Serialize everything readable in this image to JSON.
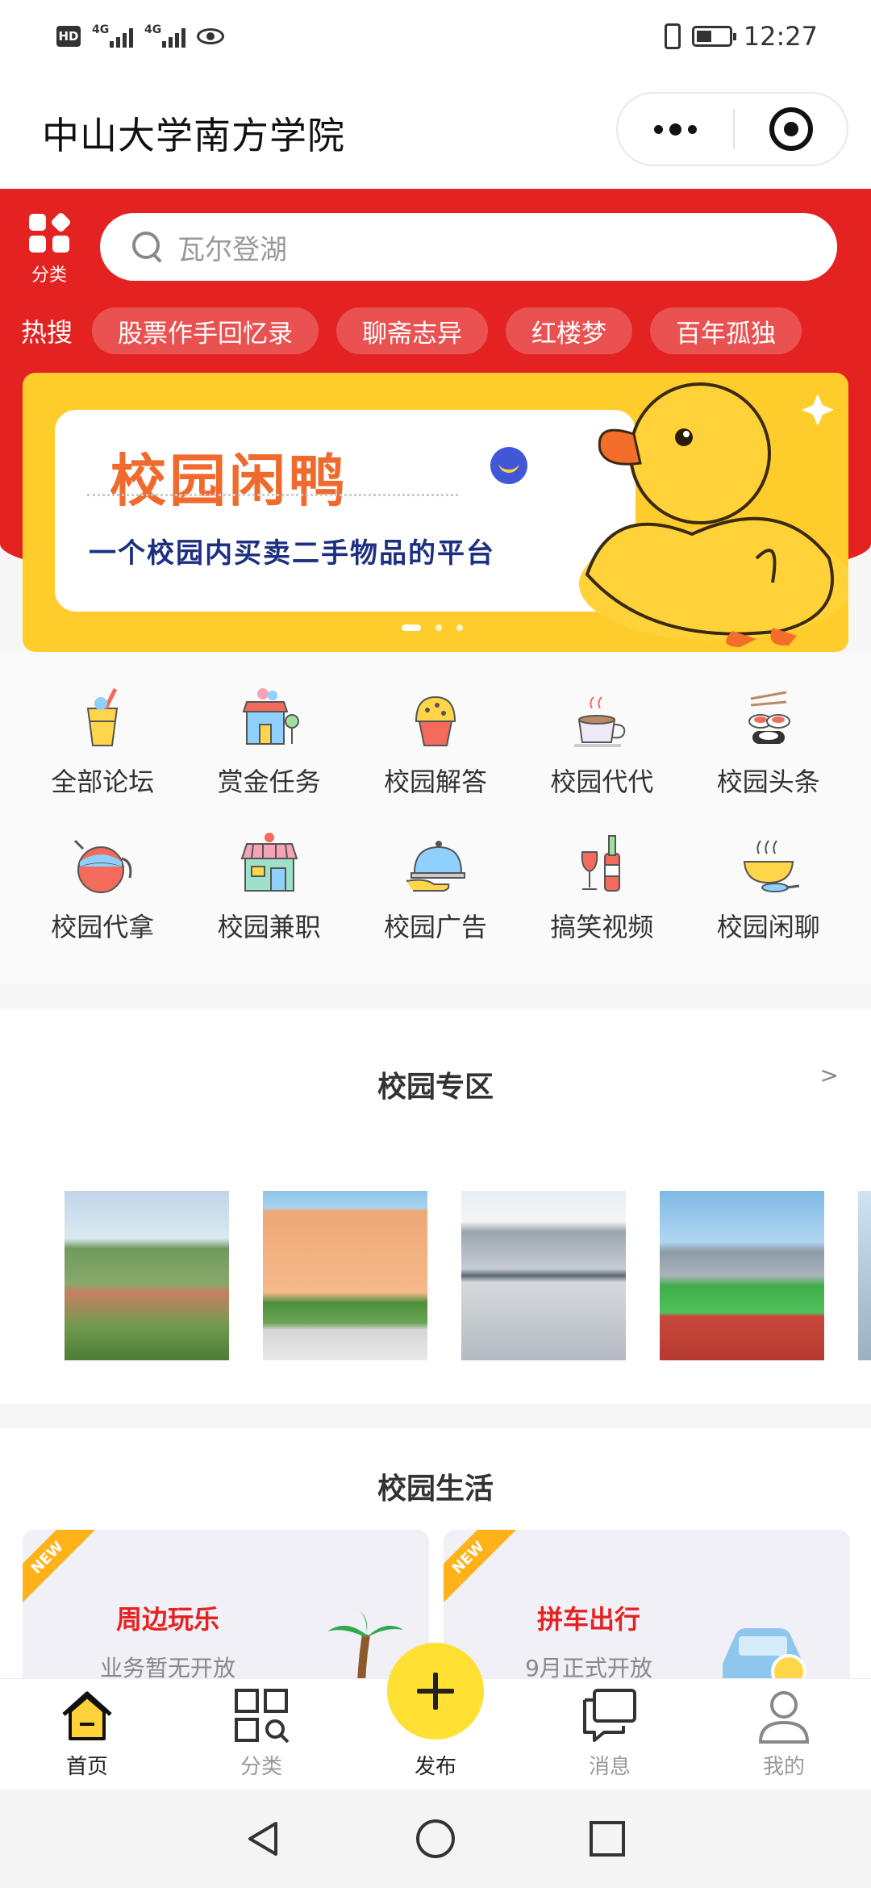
{
  "status_bar": {
    "hd": "HD",
    "net1": "4G",
    "net2": "4G",
    "time": "12:27"
  },
  "title_bar": {
    "title": "中山大学南方学院"
  },
  "header": {
    "category_label": "分类",
    "search_placeholder": "瓦尔登湖",
    "hot_label": "热搜",
    "hot_tags": [
      "股票作手回忆录",
      "聊斋志异",
      "红楼梦",
      "百年孤独"
    ]
  },
  "banner": {
    "title": "校园闲鸭",
    "subtitle": "一个校园内买卖二手物品的平台"
  },
  "menu": {
    "items": [
      {
        "label": "全部论坛",
        "icon": "drink-icon"
      },
      {
        "label": "赏金任务",
        "icon": "shop-icon"
      },
      {
        "label": "校园解答",
        "icon": "muffin-icon"
      },
      {
        "label": "校园代代",
        "icon": "coffee-cup-icon"
      },
      {
        "label": "校园头条",
        "icon": "sushi-icon"
      },
      {
        "label": "校园代拿",
        "icon": "kettle-icon"
      },
      {
        "label": "校园兼职",
        "icon": "store-icon"
      },
      {
        "label": "校园广告",
        "icon": "cloche-icon"
      },
      {
        "label": "搞笑视频",
        "icon": "wine-icon"
      },
      {
        "label": "校园闲聊",
        "icon": "soup-bowl-icon"
      }
    ]
  },
  "zone": {
    "title": "校园专区",
    "more": ">"
  },
  "life": {
    "title": "校园生活",
    "cards": [
      {
        "ribbon": "NEW",
        "name": "周边玩乐",
        "desc": "业务暂无开放"
      },
      {
        "ribbon": "NEW",
        "name": "拼车出行",
        "desc": "9月正式开放"
      }
    ]
  },
  "tab_bar": {
    "tabs": [
      {
        "label": "首页",
        "icon": "home-icon"
      },
      {
        "label": "分类",
        "icon": "category-icon"
      },
      {
        "label": "发布",
        "icon": "plus-icon"
      },
      {
        "label": "消息",
        "icon": "message-icon"
      },
      {
        "label": "我的",
        "icon": "profile-icon"
      }
    ]
  },
  "colors": {
    "accent_red": "#e52222",
    "banner_yellow": "#ffcd2b",
    "publish_yellow": "#ffe033"
  }
}
